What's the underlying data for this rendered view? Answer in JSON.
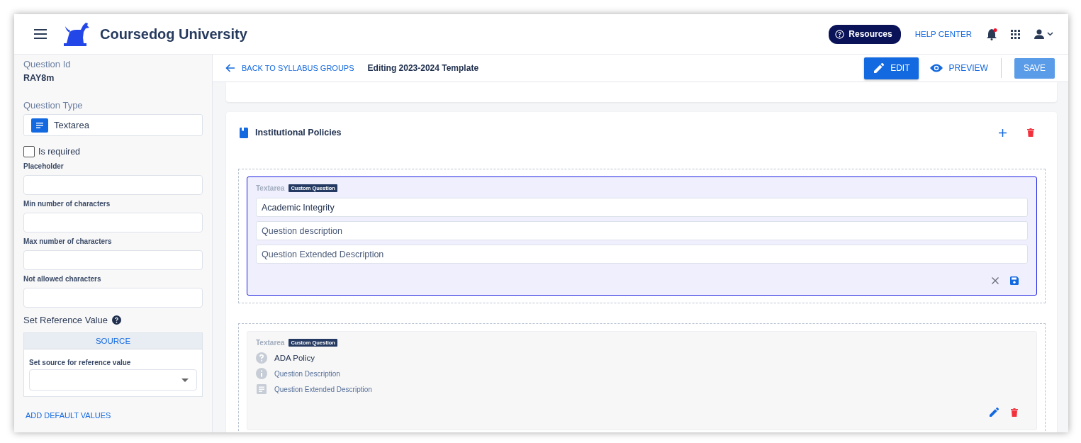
{
  "header": {
    "title": "Coursedog University",
    "resources": "Resources",
    "help_center": "HELP CENTER",
    "notification": true
  },
  "sidebar": {
    "question_id_label": "Question Id",
    "question_id": "RAY8m",
    "question_type_label": "Question Type",
    "question_type": "Textarea",
    "required": {
      "label": "Is required",
      "checked": false
    },
    "fields": [
      {
        "label": "Placeholder"
      },
      {
        "label": "Min number of characters"
      },
      {
        "label": "Max number of characters"
      },
      {
        "label": "Not allowed characters"
      }
    ],
    "reference": {
      "label": "Set Reference Value",
      "tab": "SOURCE",
      "source_label": "Set source for reference value"
    },
    "add_default": "ADD DEFAULT VALUES"
  },
  "toolbar": {
    "back": "BACK TO SYLLABUS GROUPS",
    "title": "Editing 2023-2024 Template",
    "buttons": [
      {
        "label": "EDIT",
        "selected": true
      },
      {
        "label": "PREVIEW",
        "selected": false
      }
    ],
    "save": "SAVE"
  },
  "section": {
    "title": "Institutional Policies",
    "questions": [
      {
        "kind": "editing",
        "type": "Textarea",
        "badge": "Custom Question",
        "fields": [
          {
            "value": "Academic Integrity"
          },
          {
            "placeholder": "Question description"
          },
          {
            "placeholder": "Question Extended Description"
          }
        ]
      },
      {
        "kind": "view",
        "type": "Textarea",
        "badge": "Custom Question",
        "title": "ADA Policy",
        "description": "Question Description",
        "extended": "Question Extended Description"
      }
    ]
  }
}
